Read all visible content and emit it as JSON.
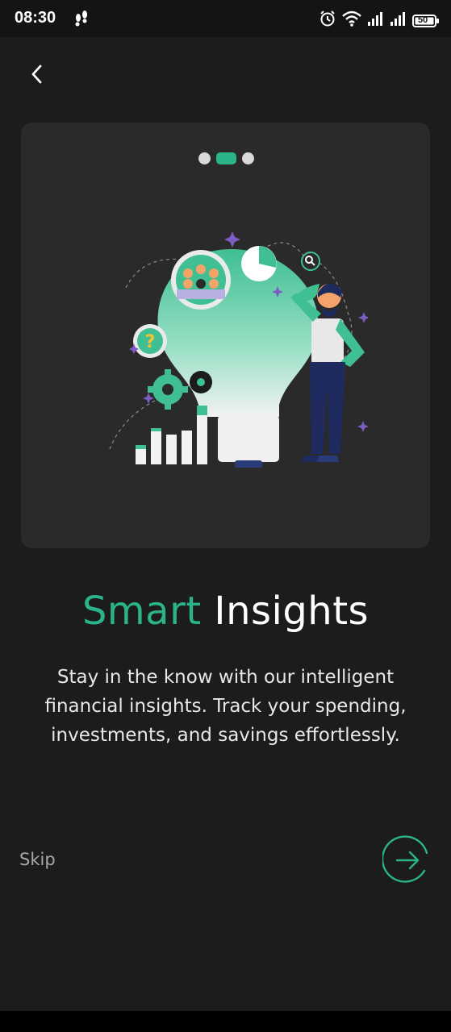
{
  "status_bar": {
    "time": "08:30",
    "battery": "50",
    "icons": [
      "footsteps-icon",
      "alarm-icon",
      "wifi-icon",
      "signal-icon",
      "signal-icon",
      "battery-icon"
    ]
  },
  "nav": {
    "back_icon": "chevron-left-icon"
  },
  "pager": {
    "total": 3,
    "active_index": 1
  },
  "title": {
    "accent": "Smart",
    "rest": "Insights"
  },
  "description": "Stay in the know with our intelligent financial insights. Track your spending, investments, and savings effortlessly.",
  "actions": {
    "skip_label": "Skip",
    "next_icon": "arrow-right-circle-icon"
  },
  "colors": {
    "accent": "#2bb38a",
    "background": "#1c1c1c",
    "card": "#2a2a2a",
    "purple": "#7b5cc4"
  }
}
